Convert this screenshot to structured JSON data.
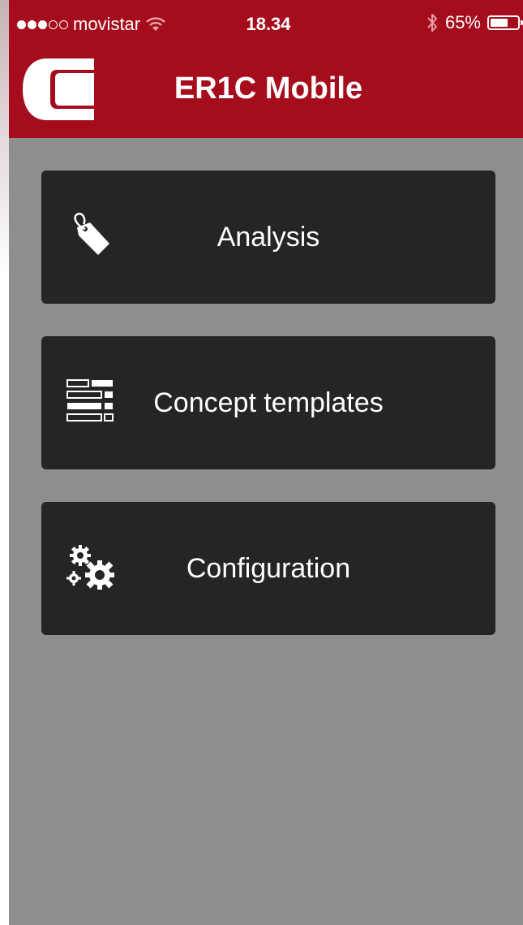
{
  "status_bar": {
    "carrier": "movistar",
    "signal_bars_filled": 3,
    "signal_bars_total": 5,
    "time": "18.34",
    "battery_percent_label": "65%",
    "battery_level": 0.65,
    "icons": [
      "wifi-icon",
      "bluetooth-icon",
      "battery-icon"
    ]
  },
  "header": {
    "title": "ER1C Mobile",
    "logo_icon": "app-logo-icon"
  },
  "menu": {
    "items": [
      {
        "label": "Analysis",
        "icon": "tag-icon"
      },
      {
        "label": "Concept templates",
        "icon": "template-list-icon"
      },
      {
        "label": "Configuration",
        "icon": "gears-icon"
      }
    ]
  },
  "colors": {
    "header_bg": "#a50d1c",
    "body_bg": "#8e8e8e",
    "menu_item_bg": "#252525",
    "text": "#ffffff"
  }
}
